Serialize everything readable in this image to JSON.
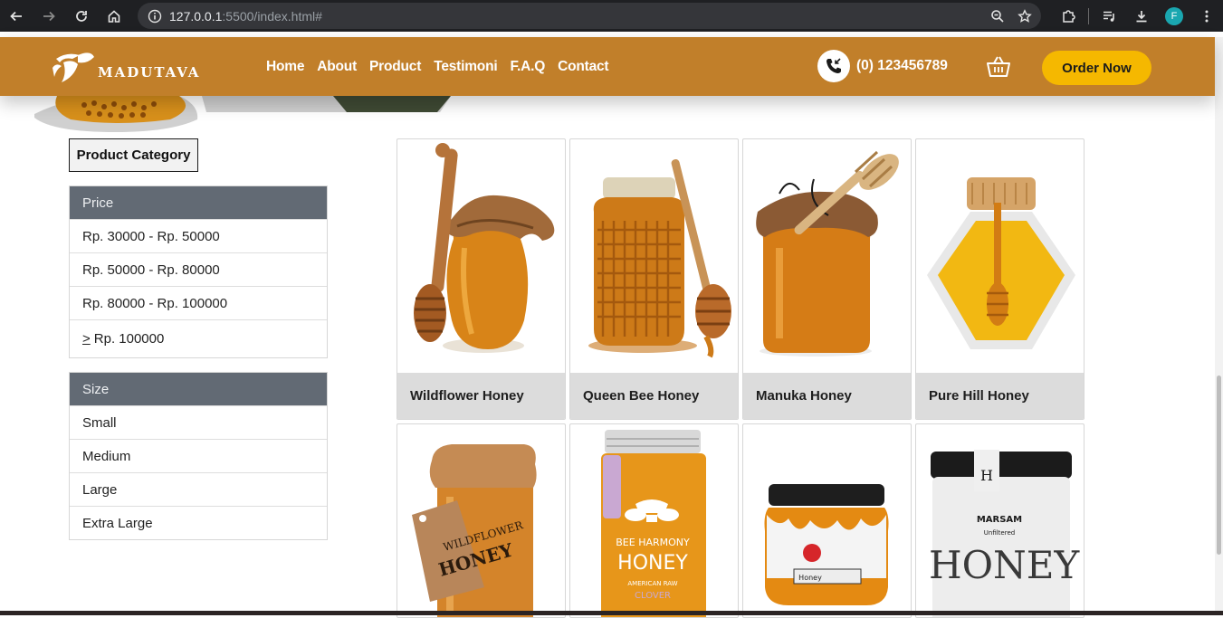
{
  "browser": {
    "url_host": "127.0.0.1",
    "url_rest": ":5500/index.html#",
    "profile_initial": "F"
  },
  "header": {
    "logo_text": "MADUTAVA",
    "nav": [
      "Home",
      "About",
      "Product",
      "Testimoni",
      "F.A.Q",
      "Contact"
    ],
    "phone": "(0) 123456789",
    "order_button": "Order Now"
  },
  "sidebar": {
    "category_button": "Product Category",
    "price": {
      "title": "Price",
      "items": [
        "Rp. 30000 - Rp. 50000",
        "Rp. 50000 - Rp. 80000",
        "Rp. 80000 - Rp. 100000"
      ],
      "last_symbol": ">",
      "last_item": "Rp. 100000"
    },
    "size": {
      "title": "Size",
      "items": [
        "Small",
        "Medium",
        "Large",
        "Extra Large"
      ]
    }
  },
  "products": {
    "row1": [
      "Wildflower Honey",
      "Queen Bee Honey",
      "Manuka Honey",
      "Pure Hill Honey"
    ],
    "row2_labels": {
      "wildflower_tag": "WILDFLOWER HONEY",
      "bee_harmony_brand": "BEE HARMONY",
      "bee_harmony_product": "HONEY",
      "bee_harmony_sub": "AMERICAN RAW",
      "bee_harmony_variety": "CLOVER",
      "jar3_label": "Honey",
      "marsam_brand": "MARSAM",
      "marsam_sub": "Unfiltered",
      "marsam_big": "HONEY"
    }
  },
  "colors": {
    "header_bg": "#c17f2a",
    "order_button": "#f5b800",
    "filter_head": "#626a74",
    "card_label_bg": "#dcdcdc"
  }
}
